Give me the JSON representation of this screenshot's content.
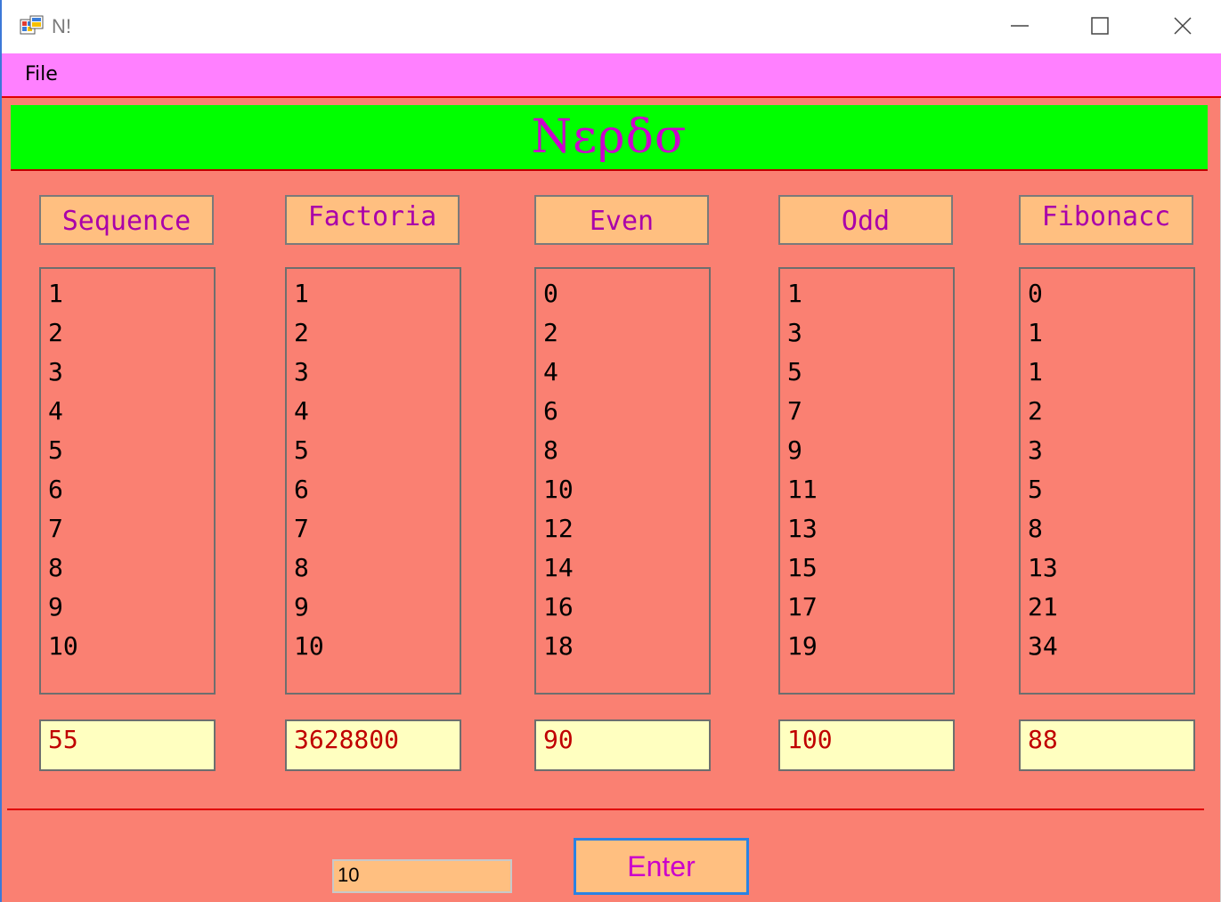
{
  "window": {
    "title": "N!",
    "icon": "winforms-app-icon"
  },
  "menu": {
    "file_label": "File"
  },
  "banner": {
    "text": "Νερδσ"
  },
  "columns": [
    {
      "header": "Sequence",
      "items": [
        "1",
        "2",
        "3",
        "4",
        "5",
        "6",
        "7",
        "8",
        "9",
        "10"
      ],
      "result": "55"
    },
    {
      "header": "Factoria",
      "items": [
        "1",
        "2",
        "3",
        "4",
        "5",
        "6",
        "7",
        "8",
        "9",
        "10"
      ],
      "result": "3628800"
    },
    {
      "header": "Even",
      "items": [
        "0",
        "2",
        "4",
        "6",
        "8",
        "10",
        "12",
        "14",
        "16",
        "18"
      ],
      "result": "90"
    },
    {
      "header": "Odd",
      "items": [
        "1",
        "3",
        "5",
        "7",
        "9",
        "11",
        "13",
        "15",
        "17",
        "19"
      ],
      "result": "100"
    },
    {
      "header": "Fibonacc",
      "items": [
        "0",
        "1",
        "1",
        "2",
        "3",
        "5",
        "8",
        "13",
        "21",
        "34"
      ],
      "result": "88"
    }
  ],
  "input": {
    "value": "10"
  },
  "enter_button": {
    "label": "Enter"
  },
  "colors": {
    "form_background": "#fa8072",
    "menubar": "#ff80ff",
    "banner": "#00ff00",
    "banner_text": "#cc00cc",
    "header_background": "#ffbf80",
    "result_background": "#ffffc0",
    "result_text": "#c00000",
    "accent_border": "#2a82e4"
  }
}
